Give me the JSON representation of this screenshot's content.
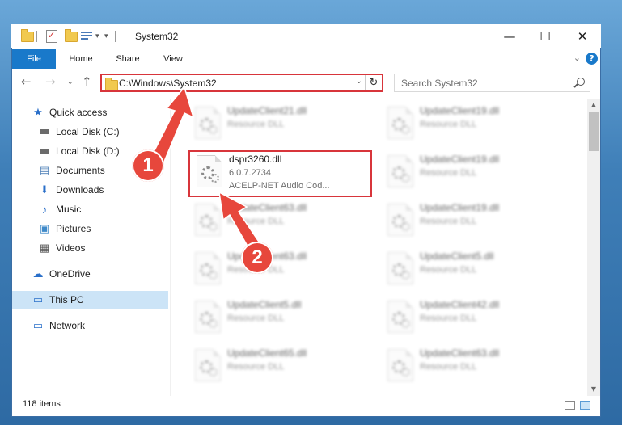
{
  "window": {
    "title": "System32",
    "minimize": "—",
    "maximize": "☐",
    "close": "✕"
  },
  "ribbon": {
    "tabs": [
      "File",
      "Home",
      "Share",
      "View"
    ],
    "help": "?"
  },
  "address": {
    "path": "C:\\Windows\\System32",
    "search_placeholder": "Search System32"
  },
  "nav": {
    "items": [
      {
        "label": "Quick access",
        "icon": "star-icon"
      },
      {
        "label": "Local Disk (C:)",
        "icon": "drive-icon"
      },
      {
        "label": "Local Disk (D:)",
        "icon": "drive-icon"
      },
      {
        "label": "Documents",
        "icon": "documents-icon"
      },
      {
        "label": "Downloads",
        "icon": "download-icon"
      },
      {
        "label": "Music",
        "icon": "music-icon"
      },
      {
        "label": "Pictures",
        "icon": "pictures-icon"
      },
      {
        "label": "Videos",
        "icon": "videos-icon"
      },
      {
        "label": "OneDrive",
        "icon": "cloud-icon"
      },
      {
        "label": "This PC",
        "icon": "pc-icon",
        "selected": true
      },
      {
        "label": "Network",
        "icon": "network-icon"
      }
    ]
  },
  "files": {
    "left": [
      {
        "name": "UpdateClient21.dll",
        "desc": "Resource DLL"
      },
      {
        "name": "dspr3260.dll",
        "version": "6.0.7.2734",
        "desc": "ACELP-NET Audio Cod..."
      },
      {
        "name": "UpdateClient63.dll",
        "desc": "Resource DLL"
      },
      {
        "name": "UpdateClient63.dll",
        "desc": "Resource DLL"
      },
      {
        "name": "UpdateClient5.dll",
        "desc": "Resource DLL"
      },
      {
        "name": "UpdateClient65.dll",
        "desc": "Resource DLL"
      }
    ],
    "right": [
      {
        "name": "UpdateClient19.dll",
        "desc": "Resource DLL"
      },
      {
        "name": "UpdateClient19.dll",
        "desc": "Resource DLL"
      },
      {
        "name": "UpdateClient19.dll",
        "desc": "Resource DLL"
      },
      {
        "name": "UpdateClient5.dll",
        "desc": "Resource DLL"
      },
      {
        "name": "UpdateClient42.dll",
        "desc": "Resource DLL"
      },
      {
        "name": "UpdateClient63.dll",
        "desc": "Resource DLL"
      }
    ]
  },
  "status": {
    "items": "118 items"
  },
  "annotations": {
    "badge1": "1",
    "badge2": "2",
    "color": "#e7473c"
  }
}
